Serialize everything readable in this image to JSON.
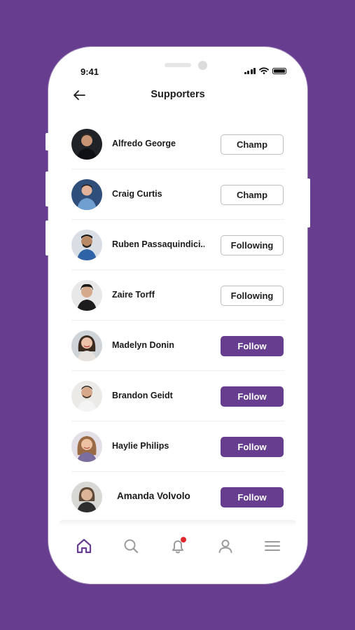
{
  "status_bar": {
    "time": "9:41"
  },
  "header": {
    "title": "Supporters"
  },
  "supporters": [
    {
      "name": "Alfredo George",
      "action": "Champ",
      "style": "outline"
    },
    {
      "name": "Craig Curtis",
      "action": "Champ",
      "style": "outline"
    },
    {
      "name": "Ruben Passaquindici...",
      "action": "Following",
      "style": "outline"
    },
    {
      "name": "Zaire Torff",
      "action": "Following",
      "style": "outline"
    },
    {
      "name": "Madelyn Donin",
      "action": "Follow",
      "style": "filled"
    },
    {
      "name": "Brandon Geidt",
      "action": "Follow",
      "style": "filled"
    },
    {
      "name": "Haylie Philips",
      "action": "Follow",
      "style": "filled"
    },
    {
      "name": "Amanda Volvolo",
      "action": "Follow",
      "style": "filled"
    }
  ],
  "tab_bar": {
    "items": [
      "home-icon",
      "search-icon",
      "bell-icon",
      "user-icon",
      "menu-icon"
    ],
    "active": "home-icon"
  },
  "colors": {
    "brand": "#673e8f",
    "notification": "#e0292e"
  }
}
